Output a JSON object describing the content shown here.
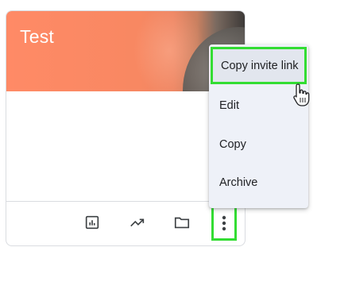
{
  "card": {
    "title": "Test",
    "footer_icons": [
      {
        "name": "gradebook-icon"
      },
      {
        "name": "trending-up-icon"
      },
      {
        "name": "folder-icon"
      },
      {
        "name": "more-vertical-icon"
      }
    ]
  },
  "menu": {
    "items": [
      {
        "label": "Copy invite link"
      },
      {
        "label": "Edit"
      },
      {
        "label": "Copy"
      },
      {
        "label": "Archive"
      }
    ]
  },
  "colors": {
    "header_accent": "#ff8a66",
    "highlight": "#33dd33",
    "menu_background": "#eef1f8"
  }
}
